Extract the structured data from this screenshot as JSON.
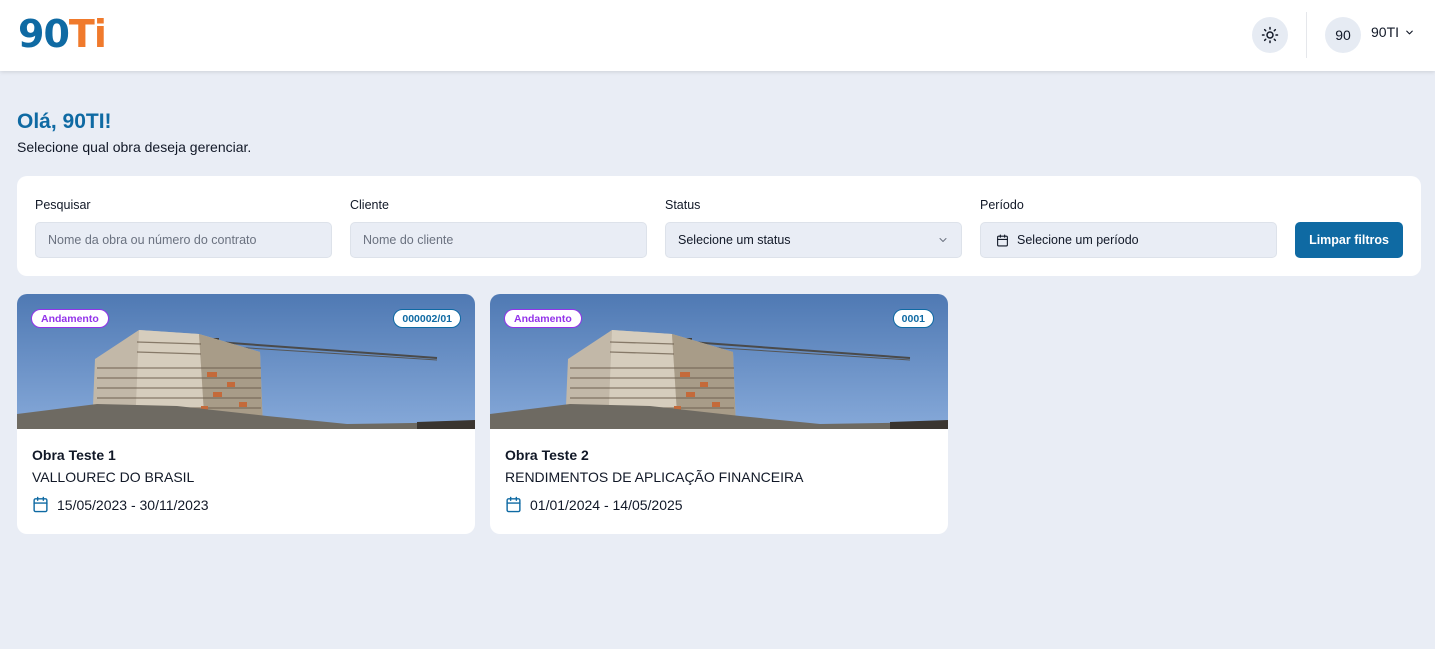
{
  "header": {
    "logo": {
      "part1": "90",
      "part2": "T",
      "part3": "i"
    },
    "theme_icon": "sun-icon",
    "avatar_initials": "90",
    "user_name": "90TI",
    "user_menu_icon": "chevron-down-icon"
  },
  "greeting": {
    "title": "Olá, 90TI!",
    "subtitle": "Selecione qual obra deseja gerenciar."
  },
  "filters": {
    "search": {
      "label": "Pesquisar",
      "placeholder": "Nome da obra ou número do contrato",
      "value": ""
    },
    "client": {
      "label": "Cliente",
      "placeholder": "Nome do cliente",
      "value": ""
    },
    "status": {
      "label": "Status",
      "selected": "Selecione um status"
    },
    "period": {
      "label": "Período",
      "selected": "Selecione um período",
      "icon": "calendar-icon"
    },
    "clear_label": "Limpar filtros"
  },
  "colors": {
    "brand_blue": "#0f6aa3",
    "brand_orange": "#f07a2c",
    "status_purple": "#9333ea",
    "background": "#e9edf5"
  },
  "projects": [
    {
      "status": "Andamento",
      "code": "000002/01",
      "title": "Obra Teste 1",
      "client": "VALLOUREC DO BRASIL",
      "dates": "15/05/2023 - 30/11/2023"
    },
    {
      "status": "Andamento",
      "code": "0001",
      "title": "Obra Teste 2",
      "client": "RENDIMENTOS DE APLICAÇÃO FINANCEIRA",
      "dates": "01/01/2024 - 14/05/2025"
    }
  ]
}
